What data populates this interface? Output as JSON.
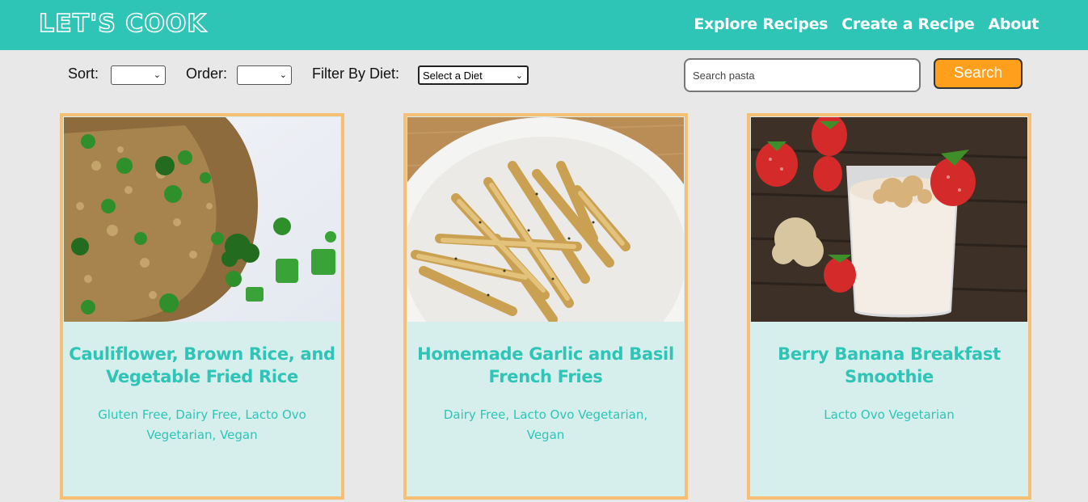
{
  "header": {
    "logo": "LET'S COOK",
    "nav": [
      "Explore Recipes",
      "Create a Recipe",
      "About"
    ]
  },
  "toolbar": {
    "sort_label": "Sort:",
    "sort_value": "",
    "order_label": "Order:",
    "order_value": "",
    "diet_label": "Filter By Diet:",
    "diet_value": "Select a Diet",
    "search_placeholder": "Search pasta",
    "search_value": "",
    "search_button": "Search"
  },
  "recipes": [
    {
      "title": "Cauliflower, Brown Rice, and Vegetable Fried Rice",
      "diets": "Gluten Free, Dairy Free, Lacto Ovo Vegetarian, Vegan",
      "image": "fried-rice-photo"
    },
    {
      "title": "Homemade Garlic and Basil French Fries",
      "diets": "Dairy Free, Lacto Ovo Vegetarian, Vegan",
      "image": "french-fries-photo"
    },
    {
      "title": "Berry Banana Breakfast Smoothie",
      "diets": "Lacto Ovo Vegetarian",
      "image": "smoothie-photo"
    }
  ],
  "colors": {
    "brand": "#2ec4b6",
    "accent": "#ff9f1c",
    "card_border": "#f7bf73",
    "card_bg": "#d7efec",
    "page_bg": "#e8e8e8"
  }
}
